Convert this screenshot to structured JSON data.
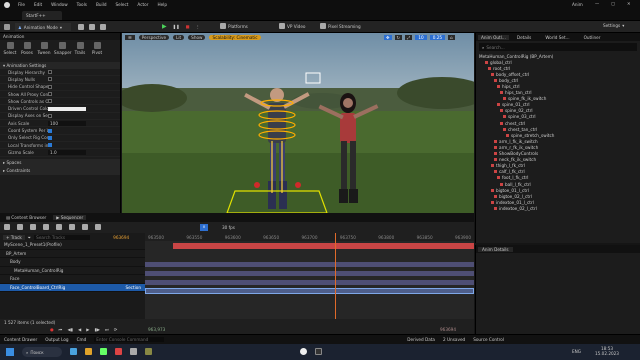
{
  "title_bar": {
    "file_tab": "StartF++",
    "menu": [
      "File",
      "Edit",
      "Window",
      "Tools",
      "Build",
      "Select",
      "Actor",
      "Help"
    ],
    "user": "Anim"
  },
  "toolbar": {
    "mode": "Animation Mode",
    "platforms": "Platforms",
    "vp_video": "VP Video",
    "pixel_streaming": "Pixel Streaming",
    "settings": "Settings"
  },
  "left_panel": {
    "title": "Animation",
    "tools": [
      "Select",
      "Poses",
      "Tween",
      "Snapper",
      "Trails",
      "Pivot"
    ],
    "section": "Animation Settings",
    "props": [
      {
        "label": "Display Hierarchy",
        "checked": false
      },
      {
        "label": "Display Nulls",
        "checked": false
      },
      {
        "label": "Hide Control Shapes",
        "checked": false
      },
      {
        "label": "Show All Proxy Controls",
        "checked": false
      },
      {
        "label": "Show Controls as Overlay",
        "checked": false
      },
      {
        "label": "Driven Control Color",
        "checked": false
      },
      {
        "label": "Display Axes on Selection",
        "checked": false
      },
      {
        "label": "Axis Scale",
        "value": "100"
      },
      {
        "label": "Coord System Per Widget",
        "checked": true
      },
      {
        "label": "Only Select Rig Controls",
        "checked": true
      },
      {
        "label": "Local Transforms in Each",
        "checked": true
      },
      {
        "label": "Gizmo Scale",
        "value": "1.0"
      }
    ],
    "groups": [
      "Spaces",
      "Constraints"
    ]
  },
  "viewport": {
    "perspective": "Perspective",
    "lit": "Lit",
    "show": "Show",
    "scalability": "Scalability: Cinematic",
    "value1": "10",
    "value2": "0.25"
  },
  "right_panel": {
    "tabs": [
      "Anim Outl...",
      "Details",
      "World Set...",
      "Outliner"
    ],
    "search_placeholder": "Search...",
    "items": [
      "MetaHuman_ControlRig (BP_Artem)",
      "global_ctrl",
      "root_ctrl",
      "body_offset_ctrl",
      "body_ctrl",
      "hips_ctrl",
      "hips_tan_ctrl",
      "spine_fk_ik_switch",
      "spine_01_ctrl",
      "spine_02_ctrl",
      "spine_03_ctrl",
      "chest_ctrl",
      "chest_tan_ctrl",
      "spine_stretch_switch",
      "arm_l_fk_ik_switch",
      "arm_r_fk_ik_switch",
      "ShowBodyControls",
      "neck_fk_ik_switch",
      "thigh_l_fk_ctrl",
      "calf_l_fk_ctrl",
      "foot_l_fk_ctrl",
      "ball_l_fk_ctrl",
      "bigtoe_01_l_ctrl",
      "bigtoe_02_l_ctrl",
      "indextoe_01_l_ctrl",
      "indextoe_02_l_ctrl"
    ],
    "details_tab": "Anim Details"
  },
  "sequencer": {
    "tabs": [
      "Content Browser",
      "Sequencer"
    ],
    "add_track": "+ Track",
    "search_placeholder": "Search Tracks",
    "fps": "30 fps",
    "current_frame": "963694",
    "start": "963694",
    "tracks": [
      "MyScene_1_Preset1(Profile)",
      "BP_Artem",
      "Body",
      "MetaHuman_ControlRig",
      "Face",
      "Face_ControlBoard_CtrlRig"
    ],
    "track_extra": "Section",
    "ruler": [
      "963500",
      "963550",
      "963600",
      "963650",
      "963700",
      "963750",
      "963800",
      "963850",
      "963900"
    ],
    "status_left": "1 527 items (1 selected)",
    "bottom_start": "963,973",
    "bottom_end": "963694"
  },
  "status_bar": {
    "content_drawer": "Content Drawer",
    "output_log": "Output Log",
    "cmd": "Cmd",
    "cmd_placeholder": "Enter Console Command",
    "derived_data": "Derived Data",
    "unsaved": "2 Unsaved",
    "source_control": "Source Control"
  },
  "taskbar": {
    "search": "Поиск",
    "time": "18:53",
    "date": "15.02.2023",
    "lang": "ENG"
  }
}
